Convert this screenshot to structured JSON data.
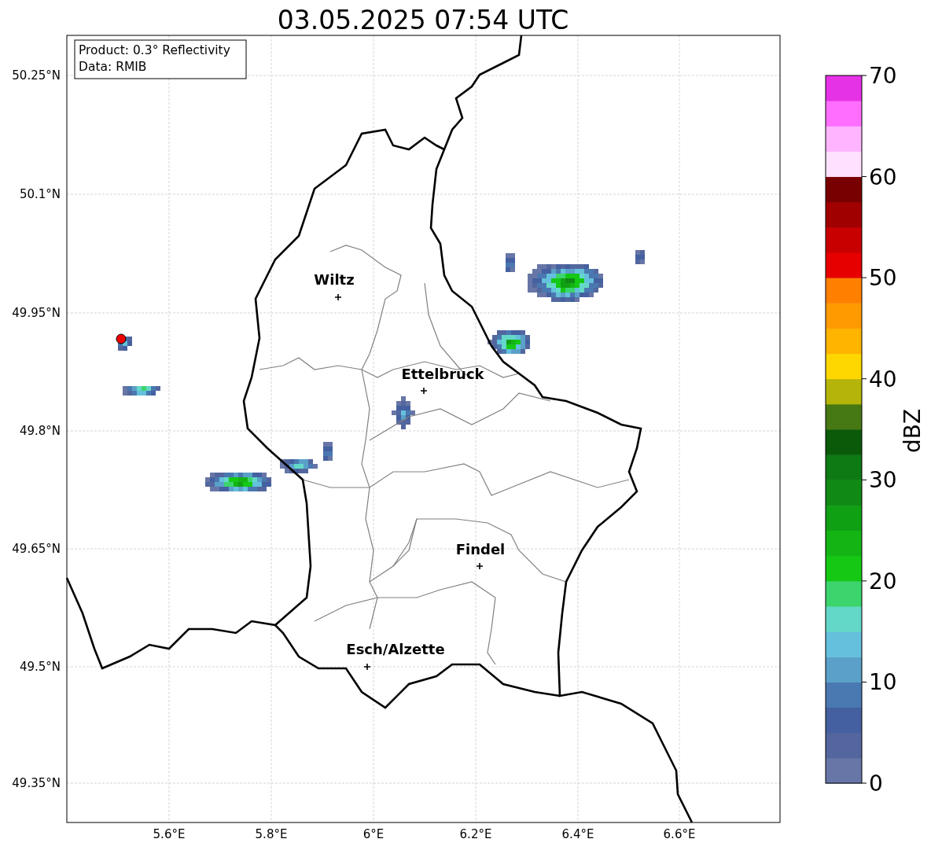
{
  "title": "03.05.2025 07:54 UTC",
  "info_box": [
    "Product: 0.3° Reflectivity",
    "Data: RMIB"
  ],
  "map": {
    "lat_labels": [
      "50.25°N",
      "50.1°N",
      "49.95°N",
      "49.8°N",
      "49.65°N",
      "49.5°N",
      "49.35°N"
    ],
    "lon_labels": [
      "5.6°E",
      "5.8°E",
      "6°E",
      "6.2°E",
      "6.4°E",
      "6.6°E"
    ],
    "places": [
      {
        "name": "Wiltz"
      },
      {
        "name": "Ettelbruck"
      },
      {
        "name": "Findel"
      },
      {
        "name": "Esch/Alzette"
      }
    ]
  },
  "colorbar": {
    "label": "dBZ",
    "ticks": [
      "70",
      "60",
      "50",
      "40",
      "30",
      "20",
      "10",
      "0"
    ],
    "segments": [
      {
        "color": "#6776a6"
      },
      {
        "color": "#53679e"
      },
      {
        "color": "#4460a0"
      },
      {
        "color": "#4a78b0"
      },
      {
        "color": "#5aa0c8"
      },
      {
        "color": "#64c0dc"
      },
      {
        "color": "#64d8c8"
      },
      {
        "color": "#3cd46c"
      },
      {
        "color": "#14c814"
      },
      {
        "color": "#14b414"
      },
      {
        "color": "#10a014"
      },
      {
        "color": "#108a14"
      },
      {
        "color": "#0e7a14"
      },
      {
        "color": "#0a5a0a"
      },
      {
        "color": "#467814"
      },
      {
        "color": "#b4b40a"
      },
      {
        "color": "#ffd700"
      },
      {
        "color": "#ffb400"
      },
      {
        "color": "#ff9a00"
      },
      {
        "color": "#ff7f00"
      },
      {
        "color": "#e60000"
      },
      {
        "color": "#c80000"
      },
      {
        "color": "#a00000"
      },
      {
        "color": "#780000"
      },
      {
        "color": "#ffe0ff"
      },
      {
        "color": "#ffb4ff"
      },
      {
        "color": "#ff6eff"
      },
      {
        "color": "#e632e6"
      }
    ]
  }
}
